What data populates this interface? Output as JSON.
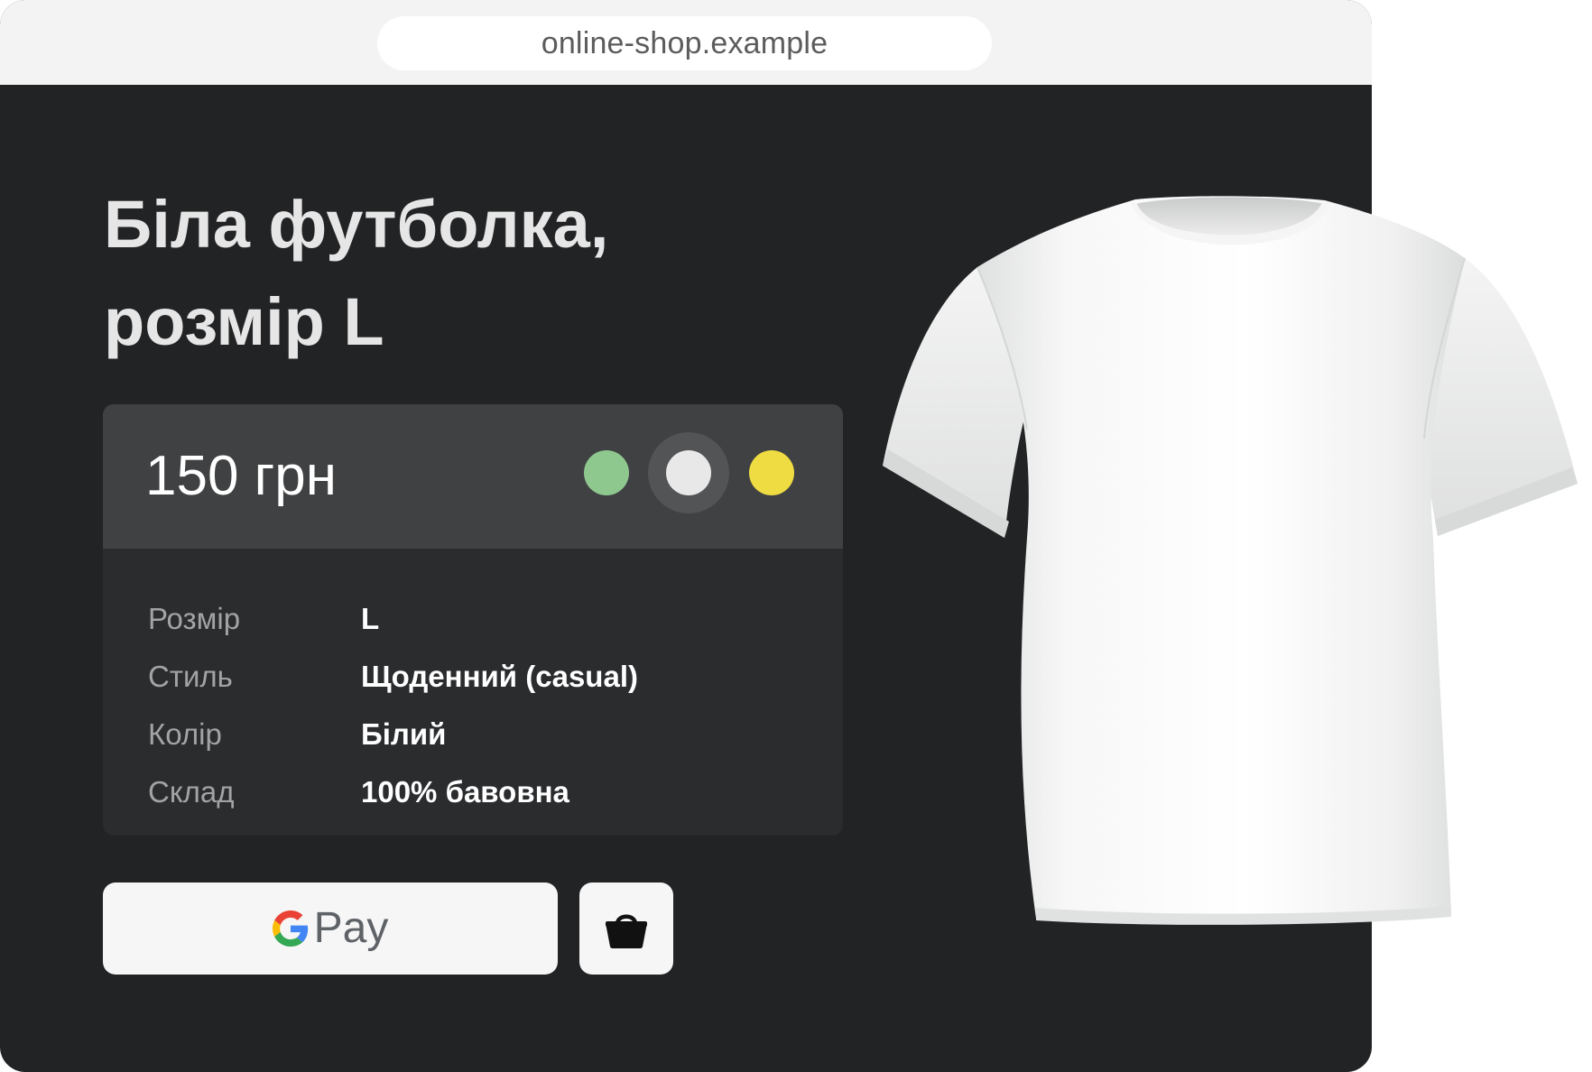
{
  "browser": {
    "url": "online-shop.example"
  },
  "product": {
    "title_line1": "Біла футболка,",
    "title_line2": "розмір L",
    "price": "150 грн",
    "color_options": [
      {
        "name": "green",
        "hex": "#8fc88f"
      },
      {
        "name": "white",
        "hex": "#e8e8e8",
        "selected": true
      },
      {
        "name": "yellow",
        "hex": "#efdc43"
      }
    ],
    "specs": [
      {
        "label": "Розмір",
        "value": "L"
      },
      {
        "label": "Стиль",
        "value": "Щоденний (casual)"
      },
      {
        "label": "Колір",
        "value": "Білий"
      },
      {
        "label": "Склад",
        "value": "100% бавовна"
      }
    ]
  },
  "actions": {
    "gpay_label": "Pay",
    "basket_icon": "shopping-basket-icon"
  },
  "theme": {
    "page_background": "#222325",
    "card_header": "#404143",
    "card_body": "#2b2c2e",
    "button_background": "#f6f6f6"
  }
}
